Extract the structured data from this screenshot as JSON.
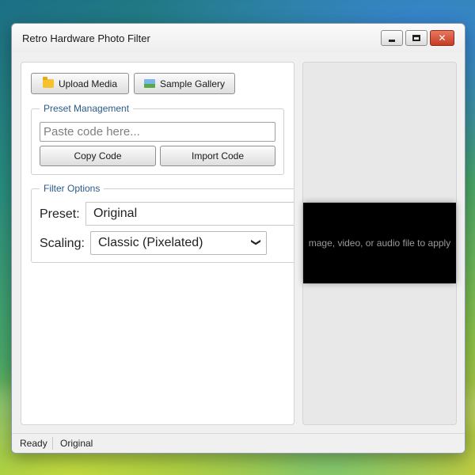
{
  "window": {
    "title": "Retro Hardware Photo Filter",
    "controls": {
      "minimize_icon": "minimize-icon",
      "maximize_icon": "maximize-icon",
      "close_icon": "close-icon",
      "close_color": "#c63b25"
    }
  },
  "toolbar": {
    "upload_label": "Upload Media",
    "upload_icon": "folder-icon",
    "sample_label": "Sample Gallery",
    "sample_icon": "image-gallery-icon"
  },
  "preset_management": {
    "legend": "Preset Management",
    "code_placeholder": "Paste code here...",
    "code_value": "",
    "copy_label": "Copy Code",
    "import_label": "Import Code"
  },
  "filter_options": {
    "legend": "Filter Options",
    "preset_label": "Preset:",
    "preset_value": "Original",
    "scaling_label": "Scaling:",
    "scaling_value": "Classic (Pixelated)"
  },
  "preview": {
    "message": "mage, video, or audio file to apply"
  },
  "status": {
    "state": "Ready",
    "preset": "Original"
  }
}
